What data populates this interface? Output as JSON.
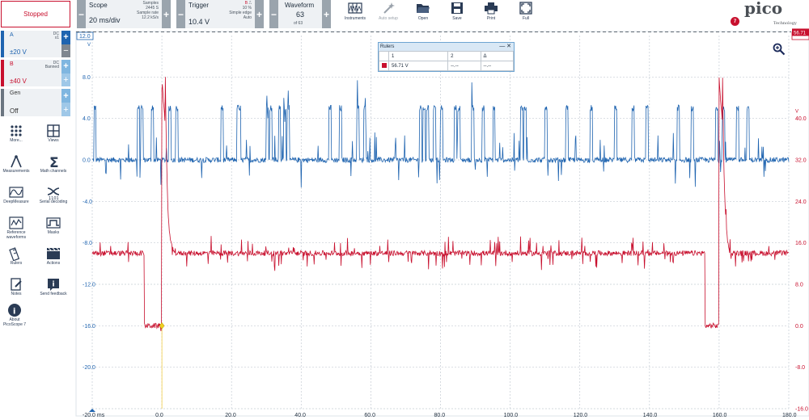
{
  "toolbar": {
    "status_label": "Stopped",
    "scope": {
      "title": "Scope",
      "value": "20 ms/div",
      "samples_label": "Samples",
      "samples_value": "2445 S",
      "rate_label": "Sample rate",
      "rate_value": "12.2 kS/s"
    },
    "trigger": {
      "title": "Trigger",
      "value": "10.4 V",
      "channel": "B",
      "percent": "10 %",
      "type": "Simple edge",
      "mode": "Auto"
    },
    "waveform": {
      "title": "Waveform",
      "value": "63",
      "of": "of 63"
    },
    "tools": [
      {
        "label": "Instruments",
        "icon": "instruments-icon"
      },
      {
        "label": "Auto setup",
        "icon": "auto-setup-icon"
      },
      {
        "label": "Open",
        "icon": "open-folder-icon"
      },
      {
        "label": "Save",
        "icon": "save-icon"
      },
      {
        "label": "Print",
        "icon": "print-icon"
      },
      {
        "label": "Full",
        "icon": "fullscreen-icon"
      }
    ],
    "logo_word": "pico",
    "logo_sub": "Technology",
    "notification_count": "7"
  },
  "channels": [
    {
      "name": "A",
      "range": "±20 V",
      "coupling": "DC",
      "probe": "x1",
      "color": "#1f64b0"
    },
    {
      "name": "B",
      "range": "±40 V",
      "coupling": "DC",
      "probe": "Banned",
      "color": "#c8102e"
    },
    {
      "name": "Gen",
      "range": "Off",
      "color": "#6b7580"
    }
  ],
  "sidebar_tools": [
    {
      "label": "More...",
      "icon": "more-icon"
    },
    {
      "label": "Views",
      "icon": "views-icon"
    },
    {
      "label": "Measurements",
      "icon": "measurements-icon"
    },
    {
      "label": "Math channels",
      "icon": "math-channels-icon"
    },
    {
      "label": "DeepMeasure",
      "icon": "deepmeasure-icon"
    },
    {
      "label": "Serial decoding",
      "icon": "serial-decoding-icon"
    },
    {
      "label": "Reference waveforms",
      "icon": "reference-waveforms-icon"
    },
    {
      "label": "Masks",
      "icon": "masks-icon"
    },
    {
      "label": "Rulers",
      "icon": "rulers-icon"
    },
    {
      "label": "Actions",
      "icon": "actions-icon"
    },
    {
      "label": "Notes",
      "icon": "notes-icon"
    },
    {
      "label": "Send feedback",
      "icon": "send-feedback-icon"
    },
    {
      "label": "About PicoScope 7",
      "icon": "about-icon"
    }
  ],
  "rulers_panel": {
    "title": "Rulers",
    "col1": "1",
    "col2": "2",
    "col3": "Δ",
    "value1": "56.71 V",
    "value2": "--.--",
    "value3": "--.--"
  },
  "chart_data": {
    "type": "line",
    "x_unit": "ms",
    "x_ticks": [
      "-20.0",
      "0.0",
      "20.0",
      "40.0",
      "60.0",
      "80.0",
      "100.0",
      "120.0",
      "140.0",
      "160.0",
      "180.0"
    ],
    "xlim": [
      -20,
      180
    ],
    "left_axis": {
      "unit": "V",
      "top_value": "12.0",
      "ticks": [
        "8.0",
        "4.0",
        "0.0",
        "-4.0",
        "-8.0",
        "-12.0",
        "-16.0",
        "-20.0"
      ],
      "ylim": [
        -24,
        12
      ],
      "color": "#1f64b0"
    },
    "right_axis": {
      "unit": "V",
      "ticks": [
        "40.0",
        "32.0",
        "24.0",
        "16.0",
        "8.0",
        "0.0",
        "-8.0",
        "-16.0"
      ],
      "ylim": [
        -16,
        56
      ],
      "color": "#c8102e",
      "ruler_value": "56.71"
    },
    "trigger_marker": {
      "x": 0,
      "y": -16
    },
    "series": [
      {
        "name": "A",
        "color": "#1f64b0",
        "baseline": 0,
        "high": 5,
        "pulse_starts": [
          -19.5,
          -7,
          -6,
          -3,
          2,
          4,
          17,
          21.5,
          22,
          30,
          31,
          33.5,
          35,
          36,
          48,
          51,
          56,
          58,
          74,
          75,
          76,
          78,
          80,
          84,
          85,
          89,
          92,
          95,
          103,
          104,
          110,
          116,
          123,
          130,
          135,
          139,
          148,
          152,
          159,
          161,
          165,
          168
        ]
      },
      {
        "name": "B",
        "color": "#c8102e",
        "baseline": 14,
        "low": 0,
        "high": 48
      }
    ]
  }
}
